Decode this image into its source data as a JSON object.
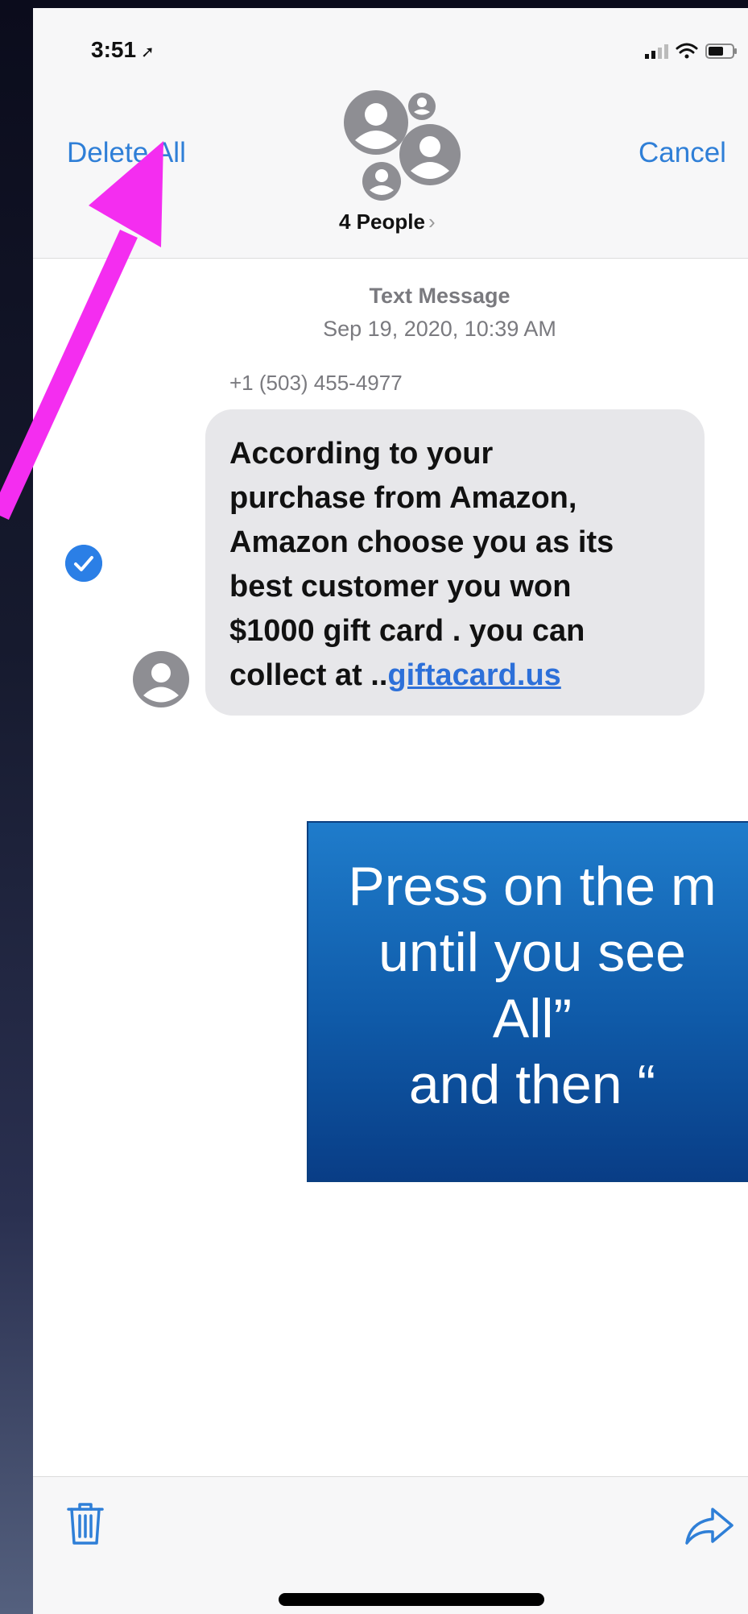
{
  "status_bar": {
    "time": "3:51",
    "location_glyph": "➚"
  },
  "nav": {
    "delete_all_label": "Delete All",
    "group_label": "4 People",
    "group_chevron": "›",
    "cancel_label": "Cancel"
  },
  "conversation": {
    "message_type": "Text Message",
    "timestamp": "Sep 19, 2020, 10:39 AM",
    "sender": "+1 (503) 455-4977",
    "message": {
      "line1": "According to your",
      "line2": "purchase from Amazon,",
      "line3": "Amazon choose you as its",
      "line4": "best customer you won",
      "line5": "$1000 gift card . you can",
      "line6_prefix": "collect at ..",
      "link": "giftacard.us"
    },
    "selected": true
  },
  "instruction": {
    "line1": "Press on the m",
    "line2": "until you see",
    "line3": "All”",
    "line4": "and then “"
  },
  "colors": {
    "accent": "#2f7fd7",
    "arrow": "#f42df0",
    "instruction_box": "#0f5aa8"
  },
  "icons": [
    "location-arrow-icon",
    "signal-icon",
    "wifi-icon",
    "battery-icon",
    "group-avatar-icon",
    "chevron-right-icon",
    "checkmark-icon",
    "person-avatar-icon",
    "trash-icon",
    "share-icon"
  ]
}
